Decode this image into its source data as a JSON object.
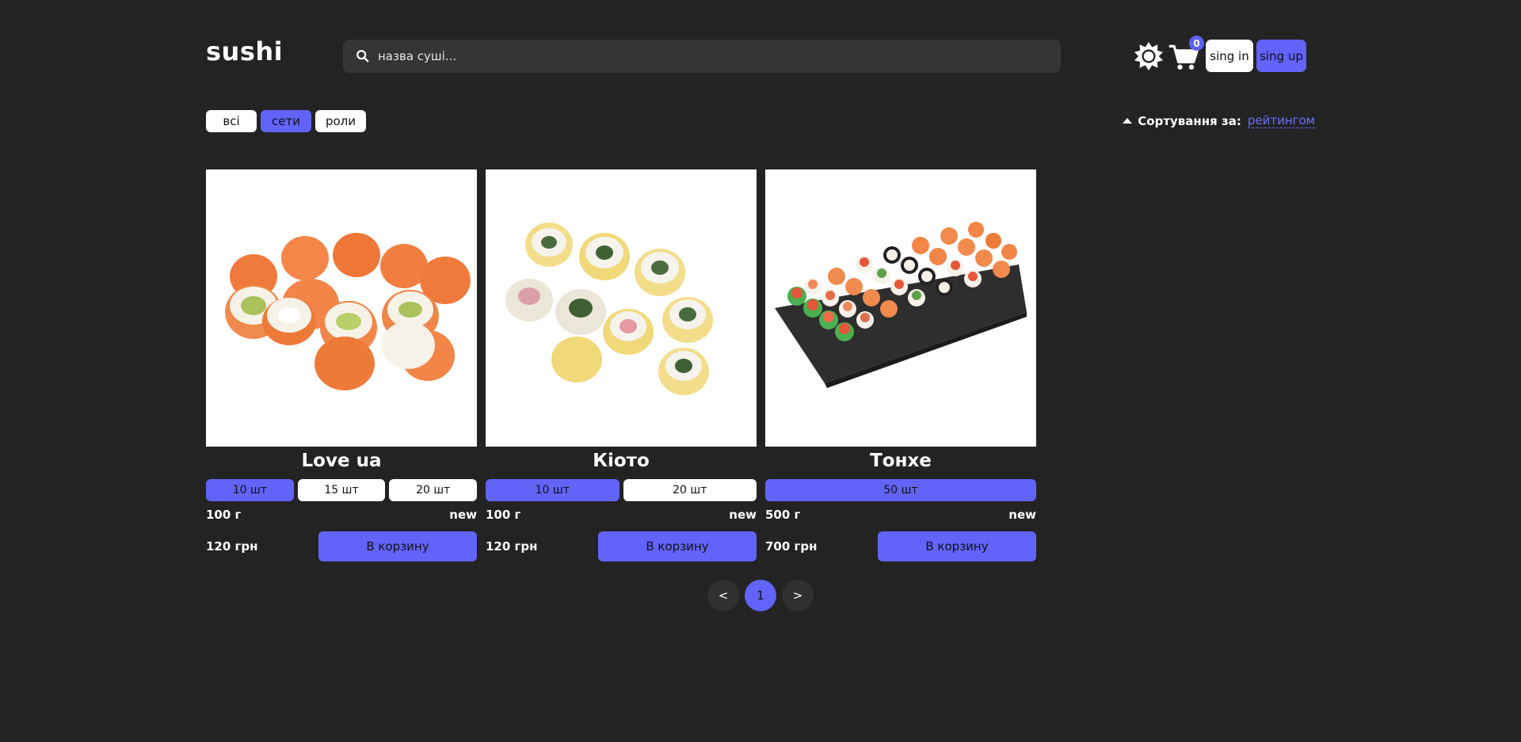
{
  "header": {
    "logo": "sushi",
    "search_placeholder": "назва суші...",
    "cart_count": "0",
    "signin_label": "sing in",
    "signup_label": "sing up"
  },
  "categories": [
    "всі",
    "сети",
    "роли"
  ],
  "active_category": "сети",
  "sort": {
    "label": "Сортування за:",
    "value": "рейтингом"
  },
  "products": [
    {
      "name": "Love ua",
      "sizes": [
        "10 шт",
        "15 шт",
        "20 шт"
      ],
      "active_size": "10 шт",
      "weight": "100 г",
      "badge": "new",
      "price": "120 грн",
      "button": "В корзину"
    },
    {
      "name": "Кіото",
      "sizes": [
        "10 шт",
        "20 шт"
      ],
      "active_size": "10 шт",
      "weight": "100 г",
      "badge": "new",
      "price": "120 грн",
      "button": "В корзину"
    },
    {
      "name": "Тонхе",
      "sizes": [
        "50 шт"
      ],
      "active_size": "50 шт",
      "weight": "500 г",
      "badge": "new",
      "price": "700 грн",
      "button": "В корзину"
    }
  ],
  "pagination": {
    "prev": "<",
    "pages": [
      "1"
    ],
    "current": "1",
    "next": ">"
  },
  "colors": {
    "background": "#232323",
    "accent": "#6163f9",
    "search_bg": "#353535"
  }
}
